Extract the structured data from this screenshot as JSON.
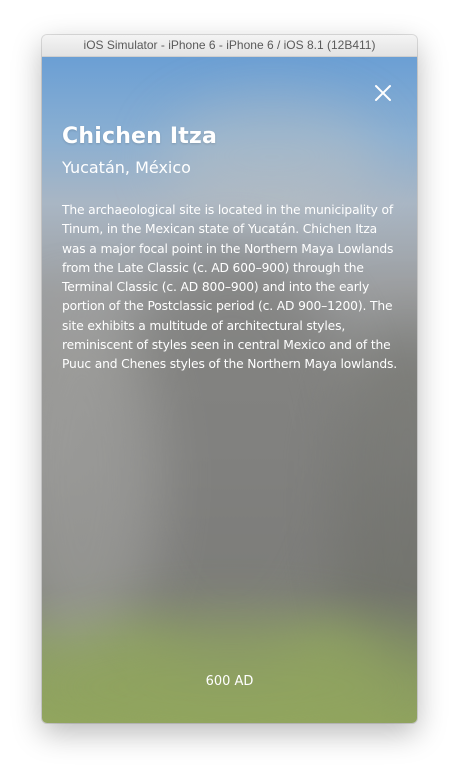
{
  "window": {
    "title": "iOS Simulator - iPhone 6 - iPhone 6 / iOS 8.1 (12B411)"
  },
  "screen": {
    "close_icon": "close-icon",
    "title": "Chichen Itza",
    "subtitle": "Yucatán, México",
    "description": "The archaeological site is located in the municipality of Tinum, in the Mexican state of Yucatán. Chichen Itza was a major focal point in the Northern Maya Lowlands from the Late Classic (c. AD 600–900) through the Terminal Classic (c. AD 800–900) and into the early portion of the Postclassic period (c. AD 900–1200). The site exhibits a multitude of architectural styles, reminiscent of styles seen in central Mexico and of the Puuc and Chenes styles of the Northern Maya lowlands.",
    "date": "600 AD"
  },
  "colors": {
    "sky": "#6b9fd4",
    "stone": "#8a8a88",
    "grass": "#93a75f",
    "text": "#ffffff"
  }
}
